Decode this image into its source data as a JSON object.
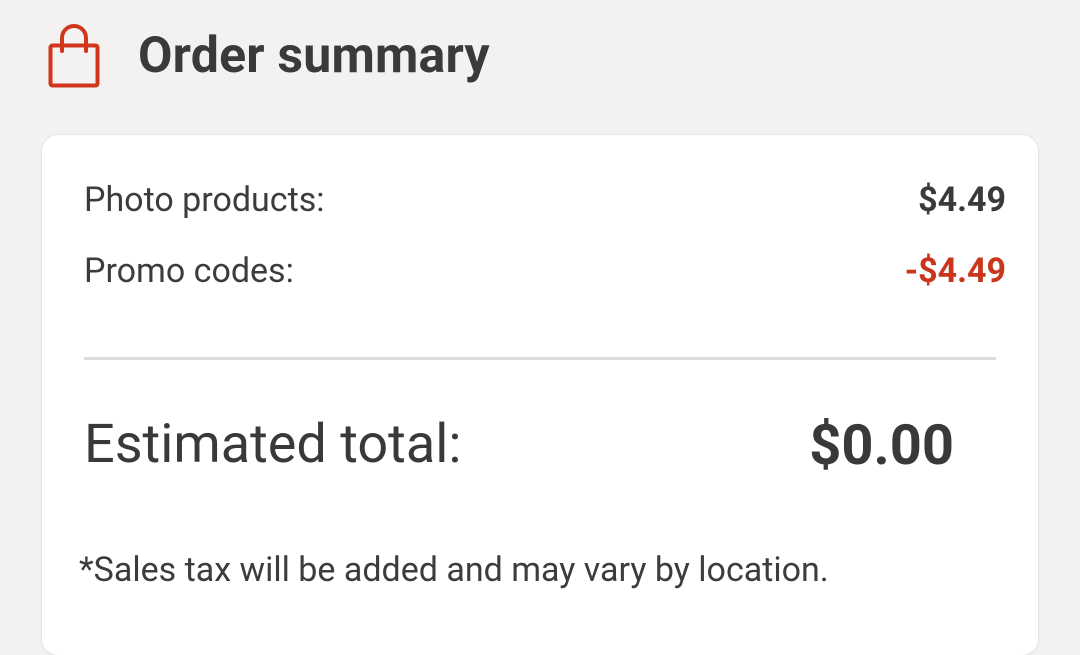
{
  "header": {
    "icon": "shopping-bag-icon",
    "title": "Order summary"
  },
  "summary": {
    "photo_products_label": "Photo products:",
    "photo_products_value": "$4.49",
    "promo_codes_label": "Promo codes:",
    "promo_codes_value": "-$4.49",
    "estimated_total_label": "Estimated total:",
    "estimated_total_value": "$0.00",
    "tax_note": "*Sales tax will be added and may vary by location."
  },
  "colors": {
    "accent": "#d1361c",
    "discount": "#c9361c",
    "text": "#3a3838",
    "background": "#f3f2f0",
    "card": "#ffffff",
    "divider": "#dedcd9"
  }
}
